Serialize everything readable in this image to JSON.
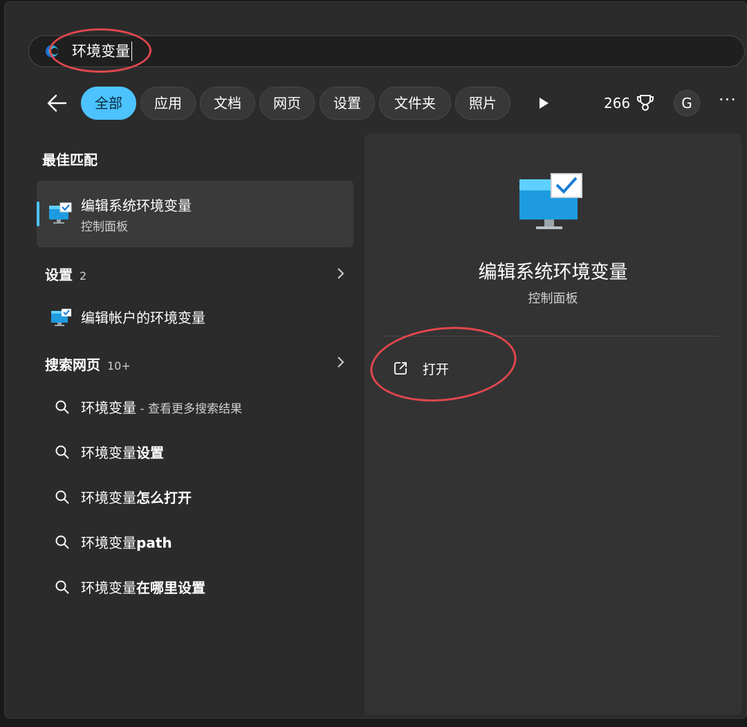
{
  "search": {
    "value": "环境变量"
  },
  "filters": {
    "tabs": [
      "全部",
      "应用",
      "文档",
      "网页",
      "设置",
      "文件夹",
      "照片"
    ],
    "active_index": 0,
    "points": "266",
    "avatar_letter": "G",
    "more": "···"
  },
  "left": {
    "best_match_title": "最佳匹配",
    "best_match": {
      "title": "编辑系统环境变量",
      "subtitle": "控制面板",
      "icon": "system-properties-monitor-icon"
    },
    "settings_section": {
      "title": "设置",
      "count": "2"
    },
    "settings_items": [
      {
        "label": "编辑帐户的环境变量",
        "icon": "system-properties-monitor-icon"
      }
    ],
    "web_section": {
      "title": "搜索网页",
      "count": "10+"
    },
    "web_items": [
      {
        "query": "环境变量",
        "bold": "",
        "suffix": " - 查看更多搜索结果"
      },
      {
        "query": "环境变量",
        "bold": "设置",
        "suffix": ""
      },
      {
        "query": "环境变量",
        "bold": "怎么打开",
        "suffix": ""
      },
      {
        "query": "环境变量",
        "bold": "path",
        "suffix": ""
      },
      {
        "query": "环境变量",
        "bold": "在哪里设置",
        "suffix": ""
      }
    ]
  },
  "right": {
    "title": "编辑系统环境变量",
    "subtitle": "控制面板",
    "actions": [
      {
        "label": "打开",
        "icon": "open-external-icon"
      }
    ]
  },
  "colors": {
    "accent": "#4cc2ff",
    "annotation": "#e0474d",
    "panel": "#333333",
    "background": "#2b2b2b"
  }
}
